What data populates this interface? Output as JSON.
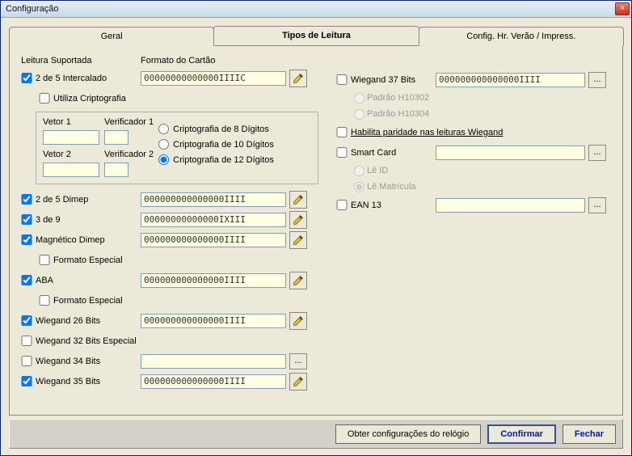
{
  "window": {
    "title": "Configuração"
  },
  "tabs": {
    "geral": "Geral",
    "tipos": "Tipos de Leitura",
    "config": "Config. Hr. Verão / Impress."
  },
  "headers": {
    "leitura": "Leitura Suportada",
    "formato": "Formato do Cartão"
  },
  "left": {
    "intercalado": {
      "label": "2 de 5 Intercalado",
      "value": "00000000000000IIIIC"
    },
    "cripto_chk": "Utiliza Criptografia",
    "vetor1": {
      "label": "Vetor 1",
      "value": ""
    },
    "vetor2": {
      "label": "Vetor 2",
      "value": ""
    },
    "verif1": {
      "label": "Verificador 1",
      "value": ""
    },
    "verif2": {
      "label": "Verificador 2",
      "value": ""
    },
    "r8": "Criptografia de 8 Dígitos",
    "r10": "Criptografia de 10 Dígitos",
    "r12": "Criptografia de 12 Dígitos",
    "dimep25": {
      "label": "2 de 5 Dimep",
      "value": "000000000000000IIII"
    },
    "tres_de_nove": {
      "label": "3 de 9",
      "value": "00000000000000IXIII"
    },
    "mag": {
      "label": "Magnético Dimep",
      "value": "000000000000000IIII"
    },
    "mag_fmt": "Formato Especial",
    "aba": {
      "label": "ABA",
      "value": "000000000000000IIII"
    },
    "aba_fmt": "Formato Especial",
    "w26": {
      "label": "Wiegand 26 Bits",
      "value": "000000000000000IIII"
    },
    "w32": {
      "label": "Wiegand 32 Bits Especial"
    },
    "w34": {
      "label": "Wiegand 34 Bits",
      "value": ""
    },
    "w35": {
      "label": "Wiegand 35 Bits",
      "value": "000000000000000IIII"
    }
  },
  "right": {
    "w37": {
      "label": "Wiegand 37 Bits",
      "value": "000000000000000IIII"
    },
    "h10302": "Padrão H10302",
    "h10304": "Padrão H10304",
    "paridade": "Habilita paridade nas leituras Wiegand",
    "smart": {
      "label": "Smart Card",
      "value": ""
    },
    "leid": "Lê ID",
    "lematricula": "Lê Matrícula",
    "ean13": {
      "label": "EAN 13",
      "value": ""
    }
  },
  "buttons": {
    "obter": "Obter configurações do relógio",
    "confirmar": "Confirmar",
    "fechar": "Fechar"
  }
}
